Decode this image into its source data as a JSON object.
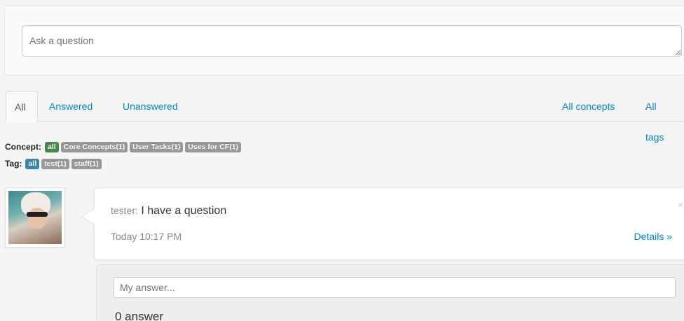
{
  "ask": {
    "placeholder": "Ask a question"
  },
  "tabs": {
    "all": "All",
    "answered": "Answered",
    "unanswered": "Unanswered",
    "all_concepts": "All concepts",
    "all_tags": "All tags"
  },
  "concept_filter": {
    "label": "Concept:",
    "items": [
      "all",
      "Core Concepts(1)",
      "User Tasks(1)",
      "Uses for CF(1)"
    ]
  },
  "tag_filter": {
    "label": "Tag:",
    "items": [
      "all",
      "test(1)",
      "staff(1)"
    ]
  },
  "question": {
    "author": "tester:",
    "text": "I have a question",
    "time": "Today 10:17 PM",
    "details": "Details »",
    "close": "×"
  },
  "answer": {
    "placeholder": "My answer...",
    "count": "0 answer"
  },
  "colors": {
    "link": "#0088cc",
    "label_active_concept": "#468847",
    "label_active_tag": "#3a87ad",
    "label_default": "#999999"
  }
}
